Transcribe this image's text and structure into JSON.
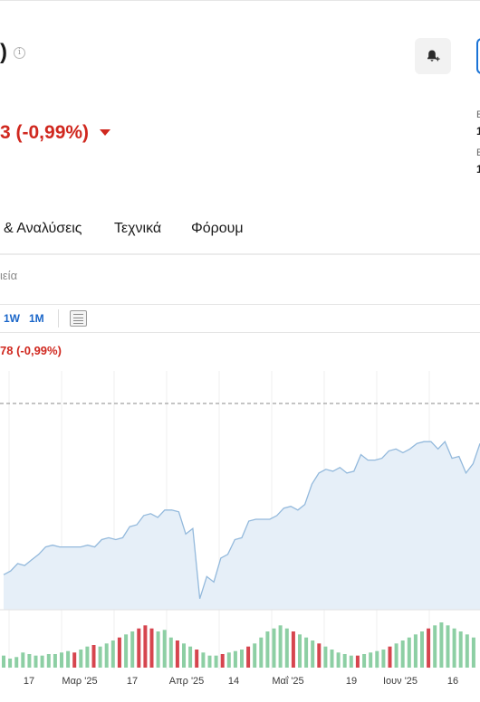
{
  "header": {
    "title_fragment": ")",
    "info_icon": "info-icon",
    "change_text": "3 (-0,99%)",
    "change_color": "#d0281f",
    "alert_icon": "bell-plus-icon",
    "side_fragments": [
      "E",
      "1",
      "E",
      "1"
    ]
  },
  "tabs": [
    {
      "label": "& Αναλύσεις"
    },
    {
      "label": "Τεχνικά"
    },
    {
      "label": "Φόρουμ"
    }
  ],
  "subheader": {
    "fragment": "ιεία"
  },
  "toolbar": {
    "ranges": [
      "1W",
      "1M"
    ],
    "table_icon": "table-icon"
  },
  "chart_header": {
    "change_text": "78 (-0,99%)"
  },
  "chart_data": {
    "type": "area",
    "price_series": [
      36,
      38,
      42,
      41,
      44,
      47,
      51,
      52,
      51,
      51,
      51,
      51,
      52,
      51,
      55,
      56,
      55,
      56,
      62,
      63,
      68,
      69,
      67,
      71,
      71,
      70,
      58,
      61,
      23,
      35,
      32,
      45,
      47,
      55,
      56,
      65,
      66,
      66,
      66,
      68,
      72,
      73,
      71,
      74,
      85,
      91,
      93,
      92,
      94,
      91,
      92,
      101,
      98,
      98,
      99,
      103,
      104,
      102,
      104,
      107,
      108,
      108,
      104,
      108,
      99,
      100,
      91,
      96,
      107
    ],
    "previous_close_line": "dashed",
    "volume_up": [
      8,
      6,
      7,
      10,
      9,
      8,
      8,
      9,
      9,
      10,
      11,
      10,
      12,
      14,
      15,
      14,
      16,
      18,
      20,
      22,
      24,
      26,
      28,
      26,
      24,
      25,
      20,
      18,
      16,
      14,
      12,
      10,
      8,
      8,
      9,
      10,
      11,
      12,
      14,
      16,
      20,
      24,
      26,
      28,
      26,
      24,
      22,
      20,
      18,
      16,
      14,
      12,
      10,
      9,
      8,
      8,
      9,
      10,
      11,
      12,
      14,
      16,
      18,
      20,
      22,
      24,
      26,
      28,
      30,
      28,
      26,
      24,
      22,
      20
    ],
    "volume_colors": {
      "up": "#8dcfa4",
      "down": "#d6454e"
    },
    "x_tick_labels": [
      "17",
      "Μαρ '25",
      "17",
      "Απρ '25",
      "14",
      "Μαΐ '25",
      "19",
      "Ιουν '25",
      "16"
    ],
    "colors": {
      "line": "#93b9dc",
      "fill": "#e6eff8",
      "grid": "#efefef"
    }
  }
}
